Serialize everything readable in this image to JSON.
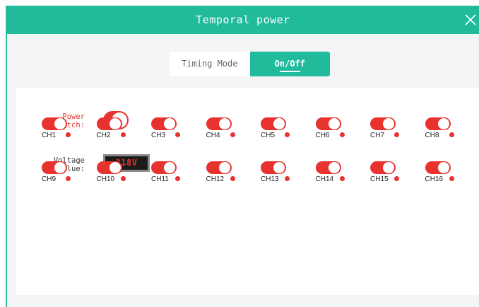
{
  "window": {
    "title": "Temporal power",
    "close_icon": "close-icon"
  },
  "tabs": [
    {
      "label": "Timing Mode",
      "active": false
    },
    {
      "label": "On/Off",
      "active": true
    }
  ],
  "power": {
    "label_line1": "Power",
    "label_line2": "switch:",
    "state": "on"
  },
  "voltage": {
    "label_line1": "Voltage",
    "label_line2": "value:",
    "value": "218V"
  },
  "channels": [
    {
      "label": "CH1"
    },
    {
      "label": "CH2"
    },
    {
      "label": "CH3"
    },
    {
      "label": "CH4"
    },
    {
      "label": "CH5"
    },
    {
      "label": "CH6"
    },
    {
      "label": "CH7"
    },
    {
      "label": "CH8"
    },
    {
      "label": "CH9"
    },
    {
      "label": "CH10"
    },
    {
      "label": "CH11"
    },
    {
      "label": "CH12"
    },
    {
      "label": "CH13"
    },
    {
      "label": "CH14"
    },
    {
      "label": "CH15"
    },
    {
      "label": "CH16"
    }
  ],
  "colors": {
    "accent": "#21bb9c",
    "toggle_on": "#e8322e",
    "status_dot": "#e8322e"
  }
}
